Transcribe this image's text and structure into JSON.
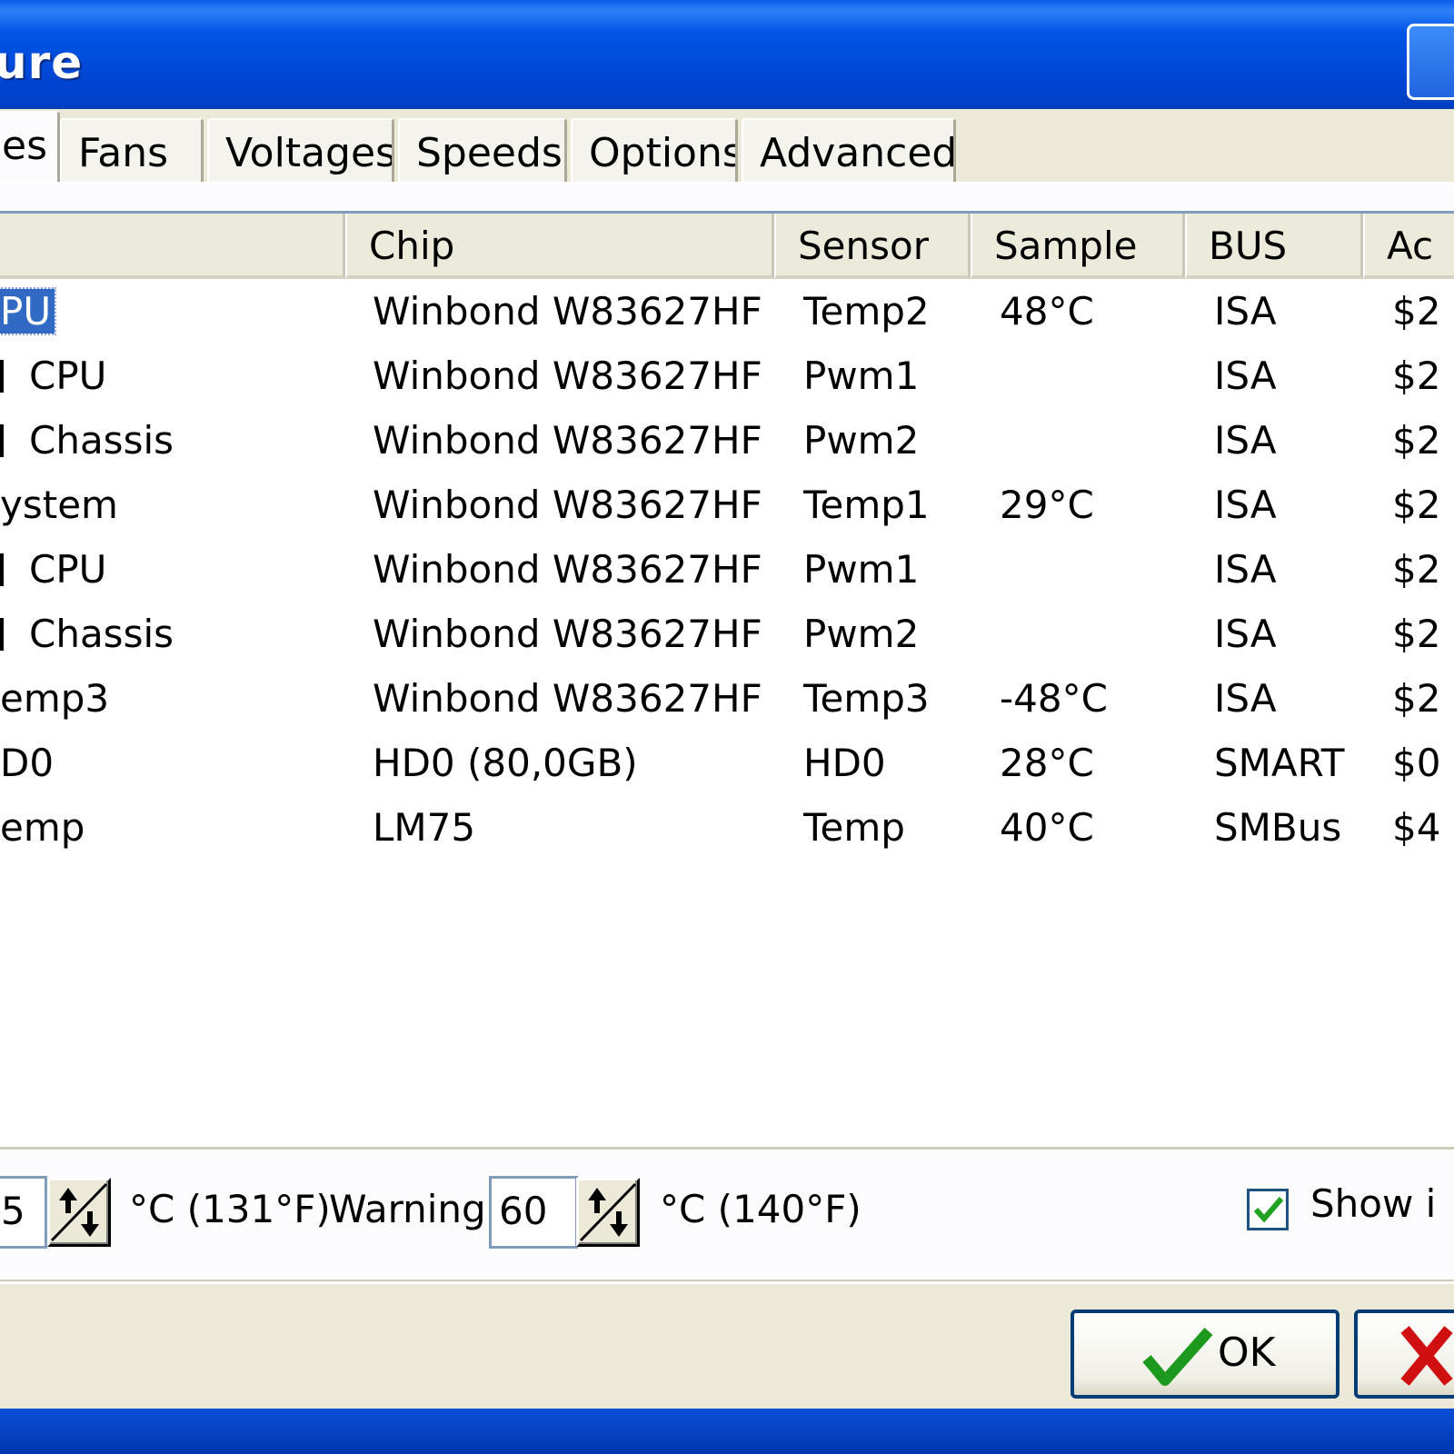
{
  "window": {
    "title_fragment": "ure"
  },
  "tabs": [
    {
      "label": "es",
      "active": true
    },
    {
      "label": "Fans"
    },
    {
      "label": "Voltages"
    },
    {
      "label": "Speeds"
    },
    {
      "label": "Options"
    },
    {
      "label": "Advanced"
    }
  ],
  "table": {
    "columns": [
      "",
      "Chip",
      "Sensor",
      "Sample",
      "BUS",
      "Ac"
    ],
    "rows": [
      {
        "name": "PU",
        "chip": "Winbond W83627HF",
        "sensor": "Temp2",
        "sample": "48°C",
        "bus": "ISA",
        "addr": "$2",
        "selected": true
      },
      {
        "name": "CPU",
        "chip": "Winbond W83627HF",
        "sensor": "Pwm1",
        "sample": "",
        "bus": "ISA",
        "addr": "$2",
        "child": true
      },
      {
        "name": "Chassis",
        "chip": "Winbond W83627HF",
        "sensor": "Pwm2",
        "sample": "",
        "bus": "ISA",
        "addr": "$2",
        "child": true
      },
      {
        "name": "ystem",
        "chip": "Winbond W83627HF",
        "sensor": "Temp1",
        "sample": "29°C",
        "bus": "ISA",
        "addr": "$2"
      },
      {
        "name": "CPU",
        "chip": "Winbond W83627HF",
        "sensor": "Pwm1",
        "sample": "",
        "bus": "ISA",
        "addr": "$2",
        "child": true
      },
      {
        "name": "Chassis",
        "chip": "Winbond W83627HF",
        "sensor": "Pwm2",
        "sample": "",
        "bus": "ISA",
        "addr": "$2",
        "child": true
      },
      {
        "name": "emp3",
        "chip": "Winbond W83627HF",
        "sensor": "Temp3",
        "sample": "-48°C",
        "bus": "ISA",
        "addr": "$2"
      },
      {
        "name": "D0",
        "chip": "HD0 (80,0GB)",
        "sensor": "HD0",
        "sample": "28°C",
        "bus": "SMART",
        "addr": "$0"
      },
      {
        "name": "emp",
        "chip": "LM75",
        "sensor": "Temp",
        "sample": "40°C",
        "bus": "SMBus",
        "addr": "$4"
      }
    ]
  },
  "footer": {
    "first_value": "5",
    "first_unit": "°C (131°F)",
    "warning_label": "Warning",
    "warning_value": "60",
    "warning_unit": "°C (140°F)",
    "show_label": "Show i",
    "show_checked": true
  },
  "buttons": {
    "ok_label": "OK"
  },
  "icons": {
    "spin": "spin-updown-icon",
    "ok": "checkmark-icon",
    "cancel": "cancel-x-icon"
  },
  "colors": {
    "selection": "#316ac5",
    "titlebar": "#0055e5"
  }
}
